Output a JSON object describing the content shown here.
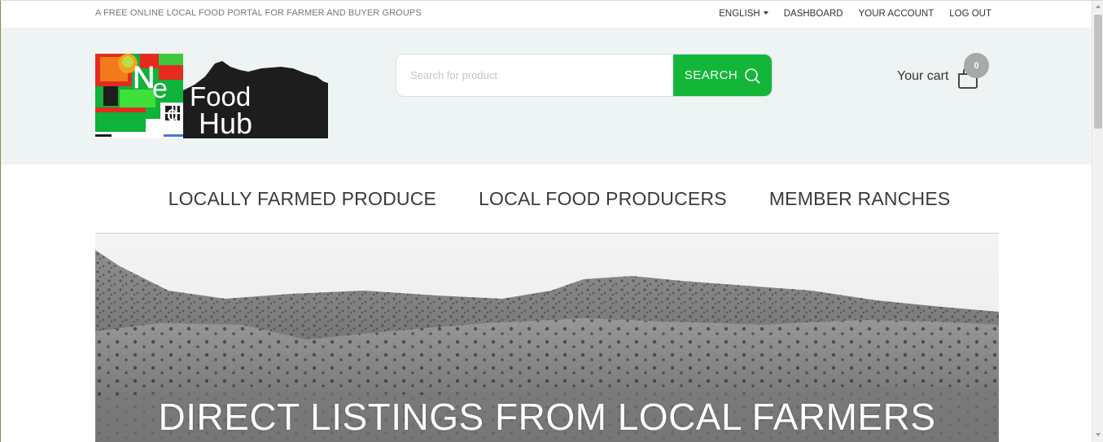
{
  "topbar": {
    "tagline": "A FREE ONLINE LOCAL FOOD PORTAL FOR FARMER AND BUYER GROUPS",
    "language": "ENGLISH",
    "dashboard": "DASHBOARD",
    "account": "YOUR ACCOUNT",
    "logout": "LOG OUT"
  },
  "logo": {
    "text_line1": "Food",
    "text_line2": "Hub",
    "letters": [
      "N",
      "e",
      "d"
    ]
  },
  "search": {
    "placeholder": "Search for product",
    "button_label": "SEARCH"
  },
  "cart": {
    "label": "Your cart",
    "count": "0"
  },
  "nav": {
    "items": [
      "LOCALLY FARMED PRODUCE",
      "LOCAL FOOD PRODUCERS",
      "MEMBER RANCHES"
    ]
  },
  "hero": {
    "title": "DIRECT LISTINGS FROM LOCAL FARMERS"
  },
  "colors": {
    "accent": "#14b63a",
    "header_bg": "#eef4f4",
    "text": "#333333"
  },
  "icons": {
    "search": "search-icon",
    "cart": "shopping-bag-icon",
    "language": "chevron-down-icon"
  }
}
